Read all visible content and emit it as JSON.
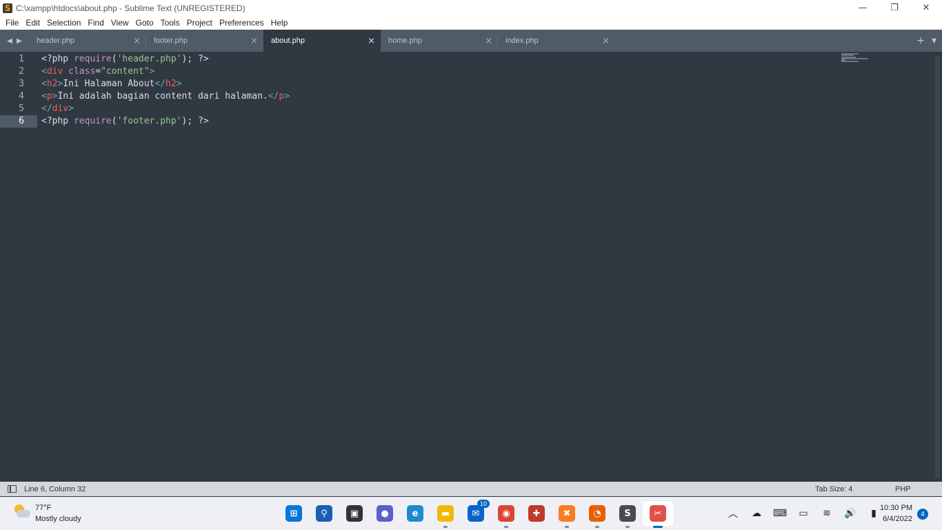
{
  "window": {
    "title": "C:\\xampp\\htdocs\\about.php - Sublime Text (UNREGISTERED)",
    "app_icon_letter": "S",
    "controls": {
      "minimize": "—",
      "restore": "❐",
      "close": "✕"
    }
  },
  "menu": [
    "File",
    "Edit",
    "Selection",
    "Find",
    "View",
    "Goto",
    "Tools",
    "Project",
    "Preferences",
    "Help"
  ],
  "tabs": [
    {
      "label": "header.php",
      "active": false
    },
    {
      "label": "footer.php",
      "active": false
    },
    {
      "label": "about.php",
      "active": true
    },
    {
      "label": "home.php",
      "active": false
    },
    {
      "label": "index.php",
      "active": false
    }
  ],
  "tab_close_glyph": "×",
  "tab_actions": {
    "new_tab": "+",
    "dropdown": "▾"
  },
  "editor": {
    "current_line": 6,
    "line_numbers": [
      "1",
      "2",
      "3",
      "4",
      "5",
      "6"
    ],
    "lines": [
      [
        {
          "t": "<?php ",
          "c": "plain"
        },
        {
          "t": "require",
          "c": "fn"
        },
        {
          "t": "(",
          "c": "plain"
        },
        {
          "t": "'header.php'",
          "c": "str"
        },
        {
          "t": "); ?>",
          "c": "plain"
        }
      ],
      [
        {
          "t": "<",
          "c": "brk"
        },
        {
          "t": "div",
          "c": "tag"
        },
        {
          "t": " ",
          "c": "plain"
        },
        {
          "t": "class",
          "c": "attr"
        },
        {
          "t": "=",
          "c": "plain"
        },
        {
          "t": "\"content\"",
          "c": "str"
        },
        {
          "t": ">",
          "c": "brk"
        }
      ],
      [
        {
          "t": "<",
          "c": "brk"
        },
        {
          "t": "h2",
          "c": "tag"
        },
        {
          "t": ">",
          "c": "brk"
        },
        {
          "t": "Ini Halaman About",
          "c": "plain"
        },
        {
          "t": "</",
          "c": "brk"
        },
        {
          "t": "h2",
          "c": "tag"
        },
        {
          "t": ">",
          "c": "brk"
        }
      ],
      [
        {
          "t": "<",
          "c": "brk"
        },
        {
          "t": "p",
          "c": "tag"
        },
        {
          "t": ">",
          "c": "brk"
        },
        {
          "t": "Ini adalah bagian content dari halaman.",
          "c": "plain"
        },
        {
          "t": "</",
          "c": "brk"
        },
        {
          "t": "p",
          "c": "tag"
        },
        {
          "t": ">",
          "c": "brk"
        }
      ],
      [
        {
          "t": "</",
          "c": "brk"
        },
        {
          "t": "div",
          "c": "tag"
        },
        {
          "t": ">",
          "c": "brk"
        }
      ],
      [
        {
          "t": "<?php ",
          "c": "plain"
        },
        {
          "t": "require",
          "c": "fn"
        },
        {
          "t": "(",
          "c": "plain"
        },
        {
          "t": "'footer.php'",
          "c": "str"
        },
        {
          "t": "); ?>",
          "c": "plain"
        }
      ]
    ]
  },
  "statusbar": {
    "position": "Line 6, Column 32",
    "tab_size": "Tab Size: 4",
    "syntax": "PHP"
  },
  "taskbar": {
    "weather": {
      "temp": "77°F",
      "condition": "Mostly cloudy"
    },
    "apps": [
      {
        "name": "start-button",
        "glyph": "⊞",
        "color": "#0a74da",
        "running": false,
        "badge": ""
      },
      {
        "name": "search-button",
        "glyph": "⚲",
        "color": "#1a5fb4",
        "running": false,
        "badge": ""
      },
      {
        "name": "task-view-button",
        "glyph": "▣",
        "color": "#333333",
        "running": false,
        "badge": ""
      },
      {
        "name": "chat-button",
        "glyph": "●",
        "color": "#5b5fc7",
        "running": false,
        "badge": ""
      },
      {
        "name": "edge-app",
        "glyph": "e",
        "color": "#1e8bd1",
        "running": false,
        "badge": ""
      },
      {
        "name": "file-explorer-app",
        "glyph": "▬",
        "color": "#f2b705",
        "running": true,
        "badge": ""
      },
      {
        "name": "mail-app",
        "glyph": "✉",
        "color": "#0a64c8",
        "running": false,
        "badge": "10"
      },
      {
        "name": "chrome-app",
        "glyph": "◉",
        "color": "#db4437",
        "running": true,
        "badge": ""
      },
      {
        "name": "gift-app",
        "glyph": "✚",
        "color": "#c0392b",
        "running": false,
        "badge": ""
      },
      {
        "name": "xampp-app",
        "glyph": "✖",
        "color": "#fb7a24",
        "running": true,
        "badge": ""
      },
      {
        "name": "firefox-app",
        "glyph": "◔",
        "color": "#e66000",
        "running": true,
        "badge": ""
      },
      {
        "name": "sublime-app",
        "glyph": "S",
        "color": "#4a4a4a",
        "running": true,
        "badge": ""
      },
      {
        "name": "snipping-tool-app",
        "glyph": "✂",
        "color": "#e2504a",
        "running": true,
        "badge": "",
        "active": true
      }
    ],
    "tray": [
      {
        "name": "chevron-up-icon",
        "glyph": "︿"
      },
      {
        "name": "onedrive-icon",
        "glyph": "☁"
      },
      {
        "name": "keyboard-icon",
        "glyph": "⌨"
      },
      {
        "name": "touchpad-icon",
        "glyph": "▭"
      },
      {
        "name": "wifi-icon",
        "glyph": "≋"
      },
      {
        "name": "volume-icon",
        "glyph": "🔊"
      },
      {
        "name": "battery-icon",
        "glyph": "▮"
      }
    ],
    "clock": {
      "time": "10:30 PM",
      "date": "6/4/2022"
    },
    "notifications": "4"
  }
}
